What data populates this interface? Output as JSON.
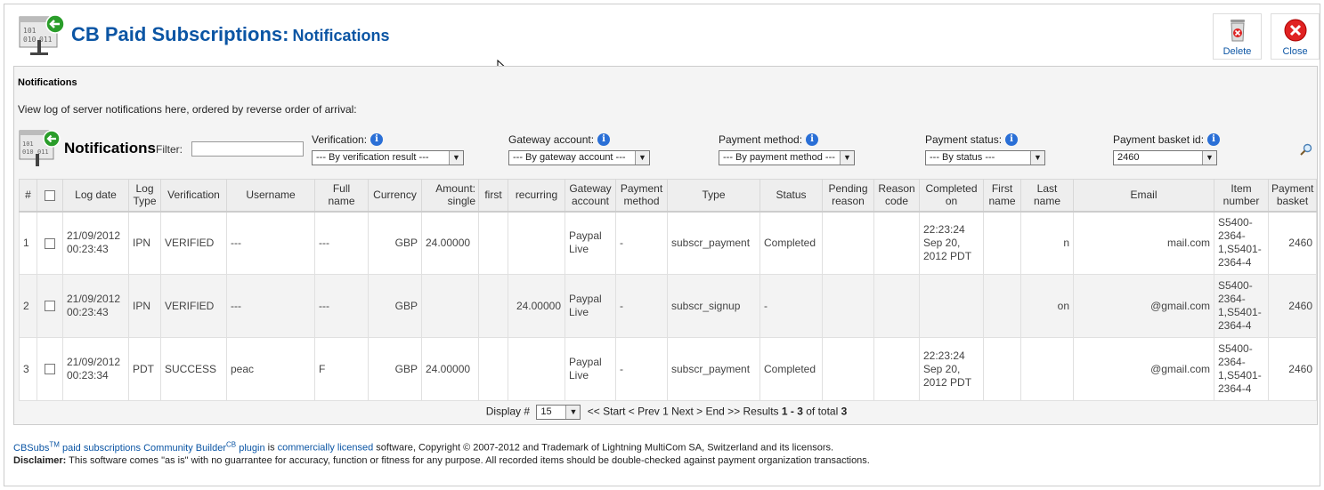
{
  "header": {
    "title": "CB Paid Subscriptions:",
    "subtitle": "Notifications",
    "delete_label": "Delete",
    "close_label": "Close"
  },
  "panel": {
    "title": "Notifications",
    "description": "View log of server notifications here, ordered by reverse order of arrival:"
  },
  "filters": {
    "heading": "Notifications",
    "filter_label": "Filter:",
    "filter_value": "",
    "groups": [
      {
        "label": "Verification:",
        "value": "--- By verification result ---"
      },
      {
        "label": "Gateway account:",
        "value": "--- By gateway account ---"
      },
      {
        "label": "Payment method:",
        "value": "--- By payment method ---"
      },
      {
        "label": "Payment status:",
        "value": "--- By status ---"
      },
      {
        "label": "Payment basket id:",
        "value": "2460"
      }
    ]
  },
  "table": {
    "columns": [
      [
        "#"
      ],
      [
        ""
      ],
      [
        "Log date"
      ],
      [
        "Log",
        "Type"
      ],
      [
        "Verification"
      ],
      [
        "Username"
      ],
      [
        "Full",
        "name"
      ],
      [
        "Currency"
      ],
      [
        "Amount:",
        "single"
      ],
      [
        "first"
      ],
      [
        "recurring"
      ],
      [
        "Gateway",
        "account"
      ],
      [
        "Payment",
        "method"
      ],
      [
        "Type"
      ],
      [
        "Status"
      ],
      [
        "Pending",
        "reason"
      ],
      [
        "Reason",
        "code"
      ],
      [
        "Completed",
        "on"
      ],
      [
        "First",
        "name"
      ],
      [
        "Last",
        "name"
      ],
      [
        "Email"
      ],
      [
        "Item",
        "number"
      ],
      [
        "Payment",
        "basket"
      ]
    ],
    "rows": [
      {
        "num": "1",
        "log_date": [
          "21/09/2012",
          "00:23:43"
        ],
        "log_type": "IPN",
        "verification": "VERIFIED",
        "username": "---",
        "full_name": "---",
        "currency": "GBP",
        "amount_single": "24.00000",
        "first": "",
        "recurring": "",
        "gateway": [
          "Paypal",
          "Live"
        ],
        "method": "-",
        "type": "subscr_payment",
        "status": "Completed",
        "pending": "",
        "reason": "",
        "completed": [
          "22:23:24",
          "Sep 20,",
          "2012 PDT"
        ],
        "first_name": "",
        "last_name": "n",
        "email": "mail.com",
        "item": [
          "S5400-",
          "2364-",
          "1,S5401-",
          "2364-4"
        ],
        "basket": "2460"
      },
      {
        "num": "2",
        "log_date": [
          "21/09/2012",
          "00:23:43"
        ],
        "log_type": "IPN",
        "verification": "VERIFIED",
        "username": "---",
        "full_name": "---",
        "currency": "GBP",
        "amount_single": "",
        "first": "",
        "recurring": "24.00000",
        "gateway": [
          "Paypal",
          "Live"
        ],
        "method": "-",
        "type": "subscr_signup",
        "status": "-",
        "pending": "",
        "reason": "",
        "completed": [
          "",
          "",
          ""
        ],
        "first_name": "",
        "last_name": "on",
        "email": "@gmail.com",
        "item": [
          "S5400-",
          "2364-",
          "1,S5401-",
          "2364-4"
        ],
        "basket": "2460"
      },
      {
        "num": "3",
        "log_date": [
          "21/09/2012",
          "00:23:34"
        ],
        "log_type": "PDT",
        "verification": "SUCCESS",
        "username": "peac",
        "full_name": "F",
        "currency": "GBP",
        "amount_single": "24.00000",
        "first": "",
        "recurring": "",
        "gateway": [
          "Paypal",
          "Live"
        ],
        "method": "-",
        "type": "subscr_payment",
        "status": "Completed",
        "pending": "",
        "reason": "",
        "completed": [
          "22:23:24",
          "Sep 20,",
          "2012 PDT"
        ],
        "first_name": "",
        "last_name": "",
        "email": "@gmail.com",
        "item": [
          "S5400-",
          "2364-",
          "1,S5401-",
          "2364-4"
        ],
        "basket": "2460"
      }
    ]
  },
  "pager": {
    "display_label": "Display #",
    "page_size": "15",
    "nav": "<< Start < Prev 1 Next > End >> Results",
    "range": "1 - 3",
    "of_total": "of total",
    "total": "3"
  },
  "footer": {
    "cbsubs": "CBSubs",
    "tm": "TM",
    "paid_text": "paid subscriptions Community Builder",
    "cb": "CB",
    "plugin": "plugin",
    "is": "is",
    "licensed": "commercially licensed",
    "rest": "software, Copyright © 2007-2012 and Trademark of Lightning MultiCom SA, Switzerland and its licensors.",
    "disclaimer_label": "Disclaimer:",
    "disclaimer": "This software comes \"as is\" with no guarrantee for accuracy, function or fitness for any purpose. All recorded items should be double-checked against payment organization transactions."
  },
  "colors": {
    "link": "#0b55a4",
    "delete_red": "#d22",
    "gateway_green": "#2a9d2a"
  }
}
